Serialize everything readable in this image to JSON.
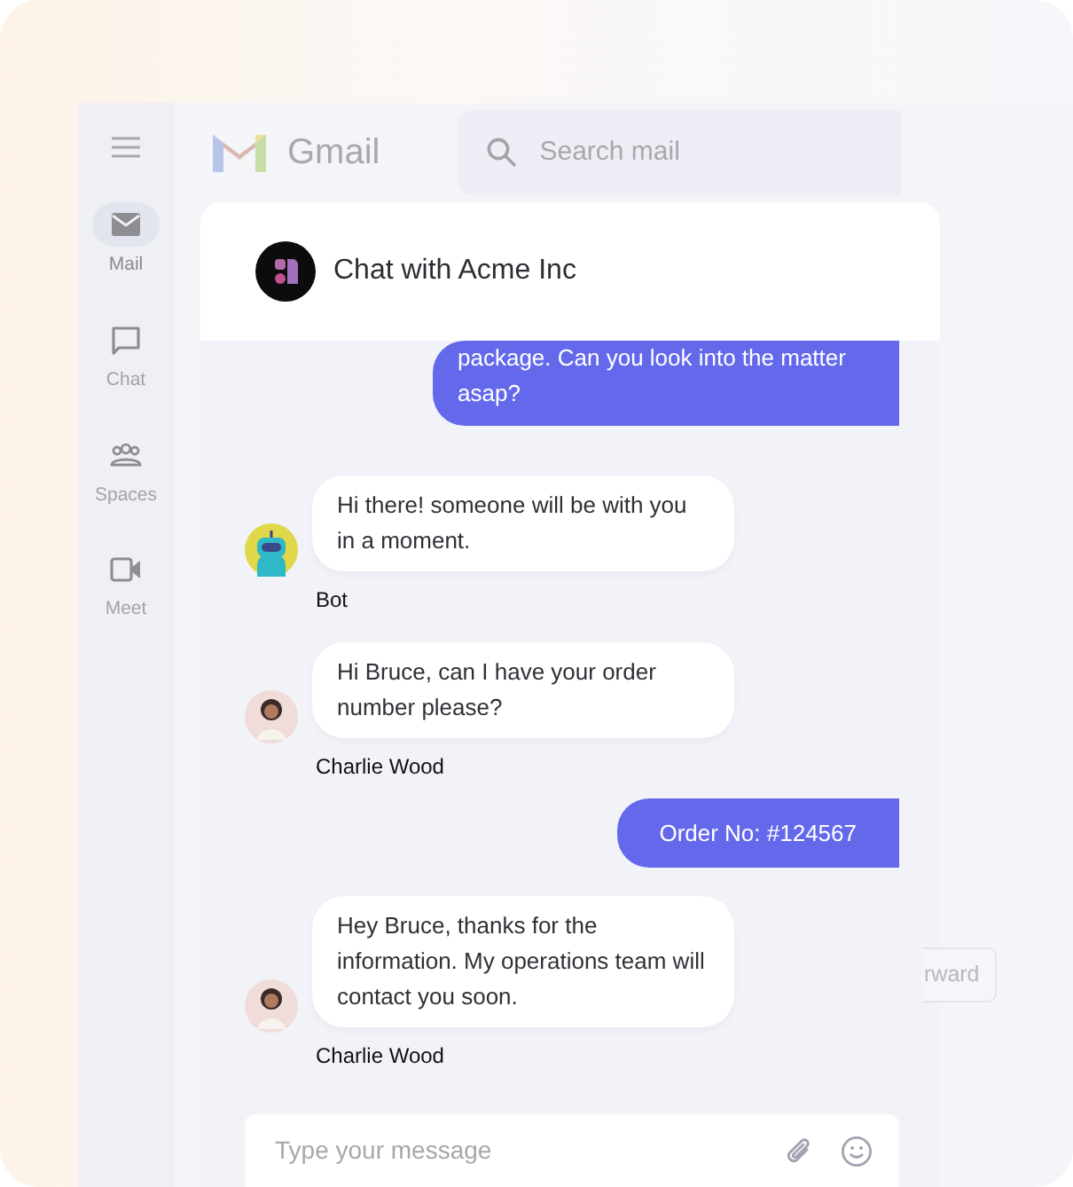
{
  "app": {
    "name": "Gmail"
  },
  "search": {
    "placeholder": "Search mail"
  },
  "nav": [
    {
      "label": "Mail",
      "selected": true
    },
    {
      "label": "Chat",
      "selected": false
    },
    {
      "label": "Spaces",
      "selected": false
    },
    {
      "label": "Meet",
      "selected": false
    }
  ],
  "chat": {
    "title": "Chat with Acme Inc",
    "messages": [
      {
        "kind": "user",
        "text": "package. Can you look into the matter asap?"
      },
      {
        "kind": "bot",
        "text": "Hi there! someone will be with you in a moment.",
        "sender": "Bot"
      },
      {
        "kind": "agent",
        "text": "Hi Bruce, can I have your order number please?",
        "sender": "Charlie Wood"
      },
      {
        "kind": "user",
        "text": "Order No: #124567"
      },
      {
        "kind": "agent",
        "text": "Hey Bruce, thanks for the information. My operations team will contact you soon.",
        "sender": "Charlie Wood"
      }
    ],
    "input": {
      "placeholder": "Type your message"
    }
  },
  "background_button": {
    "label": "rward"
  }
}
